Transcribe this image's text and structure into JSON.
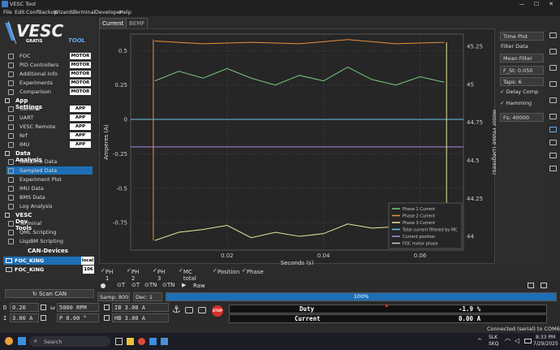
{
  "window": {
    "title": "VESC Tool",
    "min": "—",
    "max": "☐",
    "close": "✕"
  },
  "menu": [
    "File",
    "Edit",
    "ConfBackup",
    "Wizards",
    "Terminal",
    "Developer",
    "Help"
  ],
  "logo": {
    "main": "VESC",
    "sub1": "GRATIS",
    "sub2": "TOOL"
  },
  "sidebar": {
    "motor": [
      {
        "label": "FOC",
        "badge": "MOTOR"
      },
      {
        "label": "PID Controllers",
        "badge": "MOTOR"
      },
      {
        "label": "Additional Info",
        "badge": "MOTOR"
      },
      {
        "label": "Experiments",
        "badge": "MOTOR"
      },
      {
        "label": "Comparison",
        "badge": "MOTOR"
      }
    ],
    "app_head": "App Settings",
    "app": [
      {
        "label": "General",
        "badge": "APP"
      },
      {
        "label": "UART",
        "badge": "APP"
      },
      {
        "label": "VESC Remote",
        "badge": "APP"
      },
      {
        "label": "Nrf",
        "badge": "APP"
      },
      {
        "label": "IMU",
        "badge": "APP"
      }
    ],
    "data_head": "Data Analysis",
    "data": [
      "Realtime Data",
      "Sampled Data",
      "Experiment Plot",
      "IMU Data",
      "BMS Data",
      "Log Analysis"
    ],
    "dev_head": "VESC Dev Tools",
    "dev": [
      "Terminal",
      "QML Scripting",
      "LispBM Scripting"
    ],
    "can_head": "CAN-Devices",
    "can": [
      {
        "name": "FOC_KING",
        "tag": "local"
      },
      {
        "name": "FOC_KING",
        "tag": "106"
      }
    ],
    "scan": "Scan CAN"
  },
  "tabs": [
    "Current",
    "BEMF"
  ],
  "chart_data": {
    "type": "line",
    "xlabel": "Seconds (s)",
    "ylabel": "Amperes (A)",
    "y2label": "Motor Phase (Degrees)",
    "xlim": [
      0,
      0.069
    ],
    "ylim": [
      -0.95,
      0.62
    ],
    "y2lim": [
      43.91,
      45.33
    ],
    "xticks": [
      "0.02",
      "0.04",
      "0.06"
    ],
    "yticks": [
      "0.5",
      "0.25",
      "0",
      "-0.25",
      "-0.5",
      "-0.75"
    ],
    "y2ticks": [
      "45.25",
      "45",
      "44.75",
      "44.5",
      "44.25",
      "44"
    ],
    "grid": true,
    "legend_position": "bottom-right",
    "series": [
      {
        "name": "Phase 1 Current",
        "color": "#7ac77a",
        "x": [
          0.005,
          0.01,
          0.015,
          0.02,
          0.025,
          0.03,
          0.035,
          0.04,
          0.045,
          0.05,
          0.055,
          0.06,
          0.065
        ],
        "values": [
          0.28,
          0.35,
          0.3,
          0.37,
          0.3,
          0.25,
          0.32,
          0.28,
          0.38,
          0.29,
          0.25,
          0.31,
          0.27
        ]
      },
      {
        "name": "Phase 2 Current",
        "color": "#e8913a",
        "x": [
          0.005,
          0.015,
          0.025,
          0.035,
          0.045,
          0.055,
          0.065
        ],
        "values": [
          0.57,
          0.55,
          0.56,
          0.55,
          0.58,
          0.55,
          0.56
        ]
      },
      {
        "name": "Phase 3 Current",
        "color": "#e6e69a",
        "x": [
          0.005,
          0.01,
          0.015,
          0.02,
          0.025,
          0.03,
          0.035,
          0.04,
          0.045,
          0.05,
          0.055,
          0.06,
          0.065
        ],
        "values": [
          -0.88,
          -0.82,
          -0.8,
          -0.77,
          -0.86,
          -0.82,
          -0.85,
          -0.83,
          -0.76,
          -0.79,
          -0.78,
          -0.8,
          -0.84
        ]
      },
      {
        "name": "Total current filtered by MC",
        "color": "#6ec3e8",
        "x": [
          0,
          0.069
        ],
        "values": [
          0,
          0
        ]
      },
      {
        "name": "Current position",
        "color": "#b38ae8",
        "x": [
          0,
          0.069
        ],
        "values": [
          -0.2,
          -0.2
        ]
      },
      {
        "name": "FOC motor phase",
        "color": "#cccccc",
        "x": [],
        "values": []
      }
    ]
  },
  "rpanel": {
    "mode": "Time Plot",
    "filter_label": "Filter Data",
    "filter": "Mean Filter",
    "fst": "F_St: 0.050",
    "taps": "Taps: 6",
    "delay": "Delay Comp",
    "hamming": "Hamming",
    "fs": "Fs: 40000"
  },
  "checks": [
    "PH 1",
    "PH 2",
    "PH 3",
    "MC total",
    "Position",
    "Phase"
  ],
  "btnbar": {
    "items": [
      "T",
      "T",
      "TN",
      "TN"
    ],
    "raw": "Raw"
  },
  "samp": {
    "samp": "Samp: 800",
    "dec": "Dec: 1",
    "progress": "100%",
    "progress_value": 1.0
  },
  "bottom": {
    "d_label": "D",
    "d_val": "0.20",
    "w_val": "5000 RPM",
    "ib_val": "IB 3.00 A",
    "i_label": "I",
    "i_val": "3.00 A",
    "p_val": "P 0.00 °",
    "hb_val": "HB 3.00 A",
    "stop": "STOP",
    "duty_label": "Duty",
    "duty_val": "-1.9 %",
    "current_label": "Current",
    "current_val": "0.00 A"
  },
  "status": "Connected (serial) to COM6",
  "taskbar": {
    "search": "Search",
    "lang1": "SLK",
    "lang2": "SKQ",
    "time": "8:33 PM",
    "date": "7/29/2025"
  }
}
